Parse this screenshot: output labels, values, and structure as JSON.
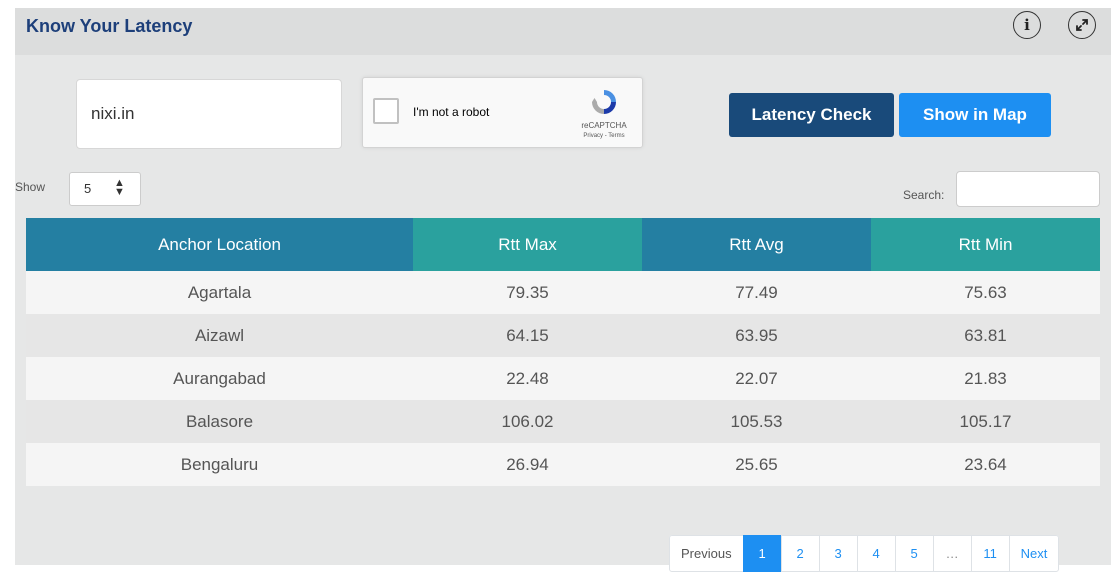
{
  "header": {
    "title": "Know Your Latency"
  },
  "form": {
    "domain_value": "nixi.in",
    "recaptcha": {
      "label": "I'm not a robot",
      "brand": "reCAPTCHA",
      "links": "Privacy - Terms"
    },
    "latency_check_label": "Latency Check",
    "show_in_map_label": "Show in Map"
  },
  "table_controls": {
    "show_label": "Show",
    "page_size": "5",
    "search_label": "Search:",
    "search_value": ""
  },
  "table": {
    "columns": [
      "Anchor Location",
      "Rtt Max",
      "Rtt Avg",
      "Rtt Min"
    ],
    "rows": [
      [
        "Agartala",
        "79.35",
        "77.49",
        "75.63"
      ],
      [
        "Aizawl",
        "64.15",
        "63.95",
        "63.81"
      ],
      [
        "Aurangabad",
        "22.48",
        "22.07",
        "21.83"
      ],
      [
        "Balasore",
        "106.02",
        "105.53",
        "105.17"
      ],
      [
        "Bengaluru",
        "26.94",
        "25.65",
        "23.64"
      ]
    ]
  },
  "pagination": {
    "previous": "Previous",
    "pages": [
      "1",
      "2",
      "3",
      "4",
      "5",
      "…",
      "11"
    ],
    "active_page": "1",
    "next": "Next"
  },
  "colors": {
    "title": "#1d3f7a",
    "latency_button": "#194a7a",
    "map_button": "#1d8ff2",
    "header_col_blue": "#247fa2",
    "header_col_teal": "#2aa19e"
  },
  "icons": [
    "info-icon",
    "expand-icon",
    "recaptcha-logo-icon",
    "sort-caret-icon"
  ]
}
